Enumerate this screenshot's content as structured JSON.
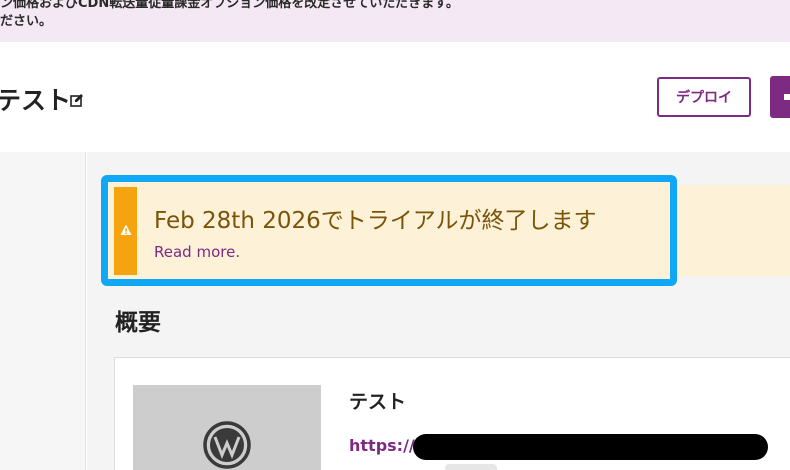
{
  "notice": {
    "line1": "ン価格およびCDN転送量従量課金オプション価格を改定させていただきます。",
    "line2": "ださい。"
  },
  "header": {
    "site_title": "テスト",
    "edit_icon": "edit-icon",
    "deploy_label": "デプロイ",
    "primary_icon": "plus-icon"
  },
  "trial_banner": {
    "title": "Feb 28th 2026でトライアルが終了します",
    "link": "Read more.",
    "icon": "warning-icon"
  },
  "overview": {
    "heading": "概要"
  },
  "site_card": {
    "title": "テスト",
    "url_prefix": "https://",
    "logo": "wordpress-logo"
  },
  "colors": {
    "brand": "#7d2a82",
    "highlight": "#10a7f5",
    "warning": "#f5a30f",
    "banner_bg": "#fdf1d8",
    "notice_bg": "#f3e8f3"
  }
}
